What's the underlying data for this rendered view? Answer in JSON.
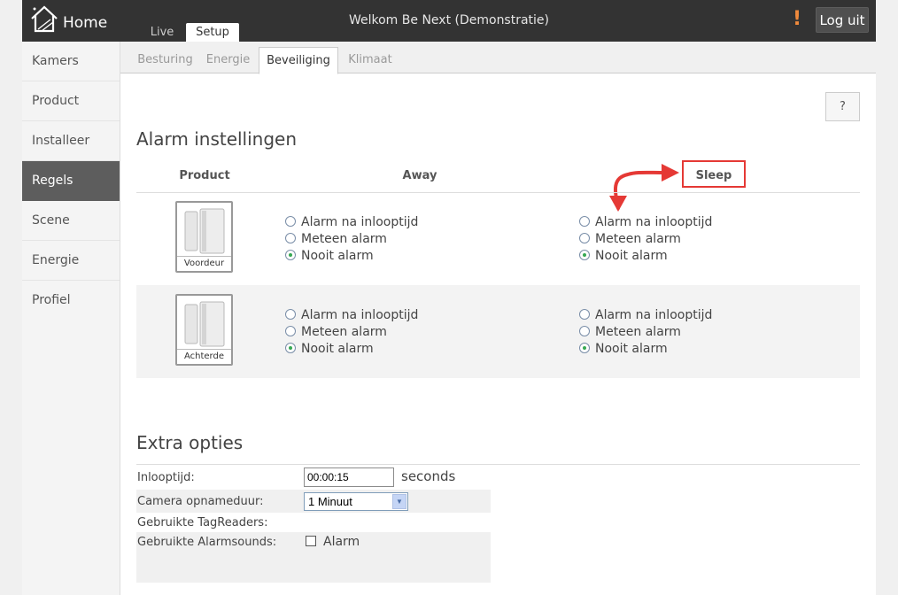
{
  "header": {
    "logo_label": "Home",
    "welcome": "Welkom Be Next (Demonstratie)",
    "tabs": [
      {
        "label": "Live"
      },
      {
        "label": "Setup"
      }
    ],
    "warning_glyph": "!",
    "logout_label": "Log uit",
    "warning_color": "#f08a3c"
  },
  "sidebar": {
    "items": [
      {
        "label": "Kamers"
      },
      {
        "label": "Product"
      },
      {
        "label": "Installeer"
      },
      {
        "label": "Regels"
      },
      {
        "label": "Scene"
      },
      {
        "label": "Energie"
      },
      {
        "label": "Profiel"
      }
    ],
    "active": "Regels"
  },
  "subtabs": {
    "items": [
      {
        "label": "Besturing"
      },
      {
        "label": "Energie"
      },
      {
        "label": "Beveiliging"
      },
      {
        "label": "Klimaat"
      }
    ],
    "active": "Beveiliging"
  },
  "help_label": "?",
  "alarm": {
    "title": "Alarm instellingen",
    "col_product": "Product",
    "col_away": "Away",
    "col_sleep": "Sleep",
    "highlight_color": "#e53935",
    "options": [
      "Alarm na inlooptijd",
      "Meteen alarm",
      "Nooit alarm"
    ],
    "rows": [
      {
        "product": "Voordeur",
        "away_selected": "Nooit alarm",
        "sleep_selected": "Nooit alarm"
      },
      {
        "product": "Achterde",
        "away_selected": "Nooit alarm",
        "sleep_selected": "Nooit alarm"
      }
    ]
  },
  "extra": {
    "title": "Extra opties",
    "inlooptijd_label": "Inlooptijd:",
    "inlooptijd_value": "00:00:15",
    "inlooptijd_unit": "seconds",
    "camera_label": "Camera opnameduur:",
    "camera_value": "1 Minuut",
    "tagreaders_label": "Gebruikte TagReaders:",
    "alarmsounds_label": "Gebruikte Alarmsounds:",
    "alarmsounds_option": "Alarm"
  }
}
